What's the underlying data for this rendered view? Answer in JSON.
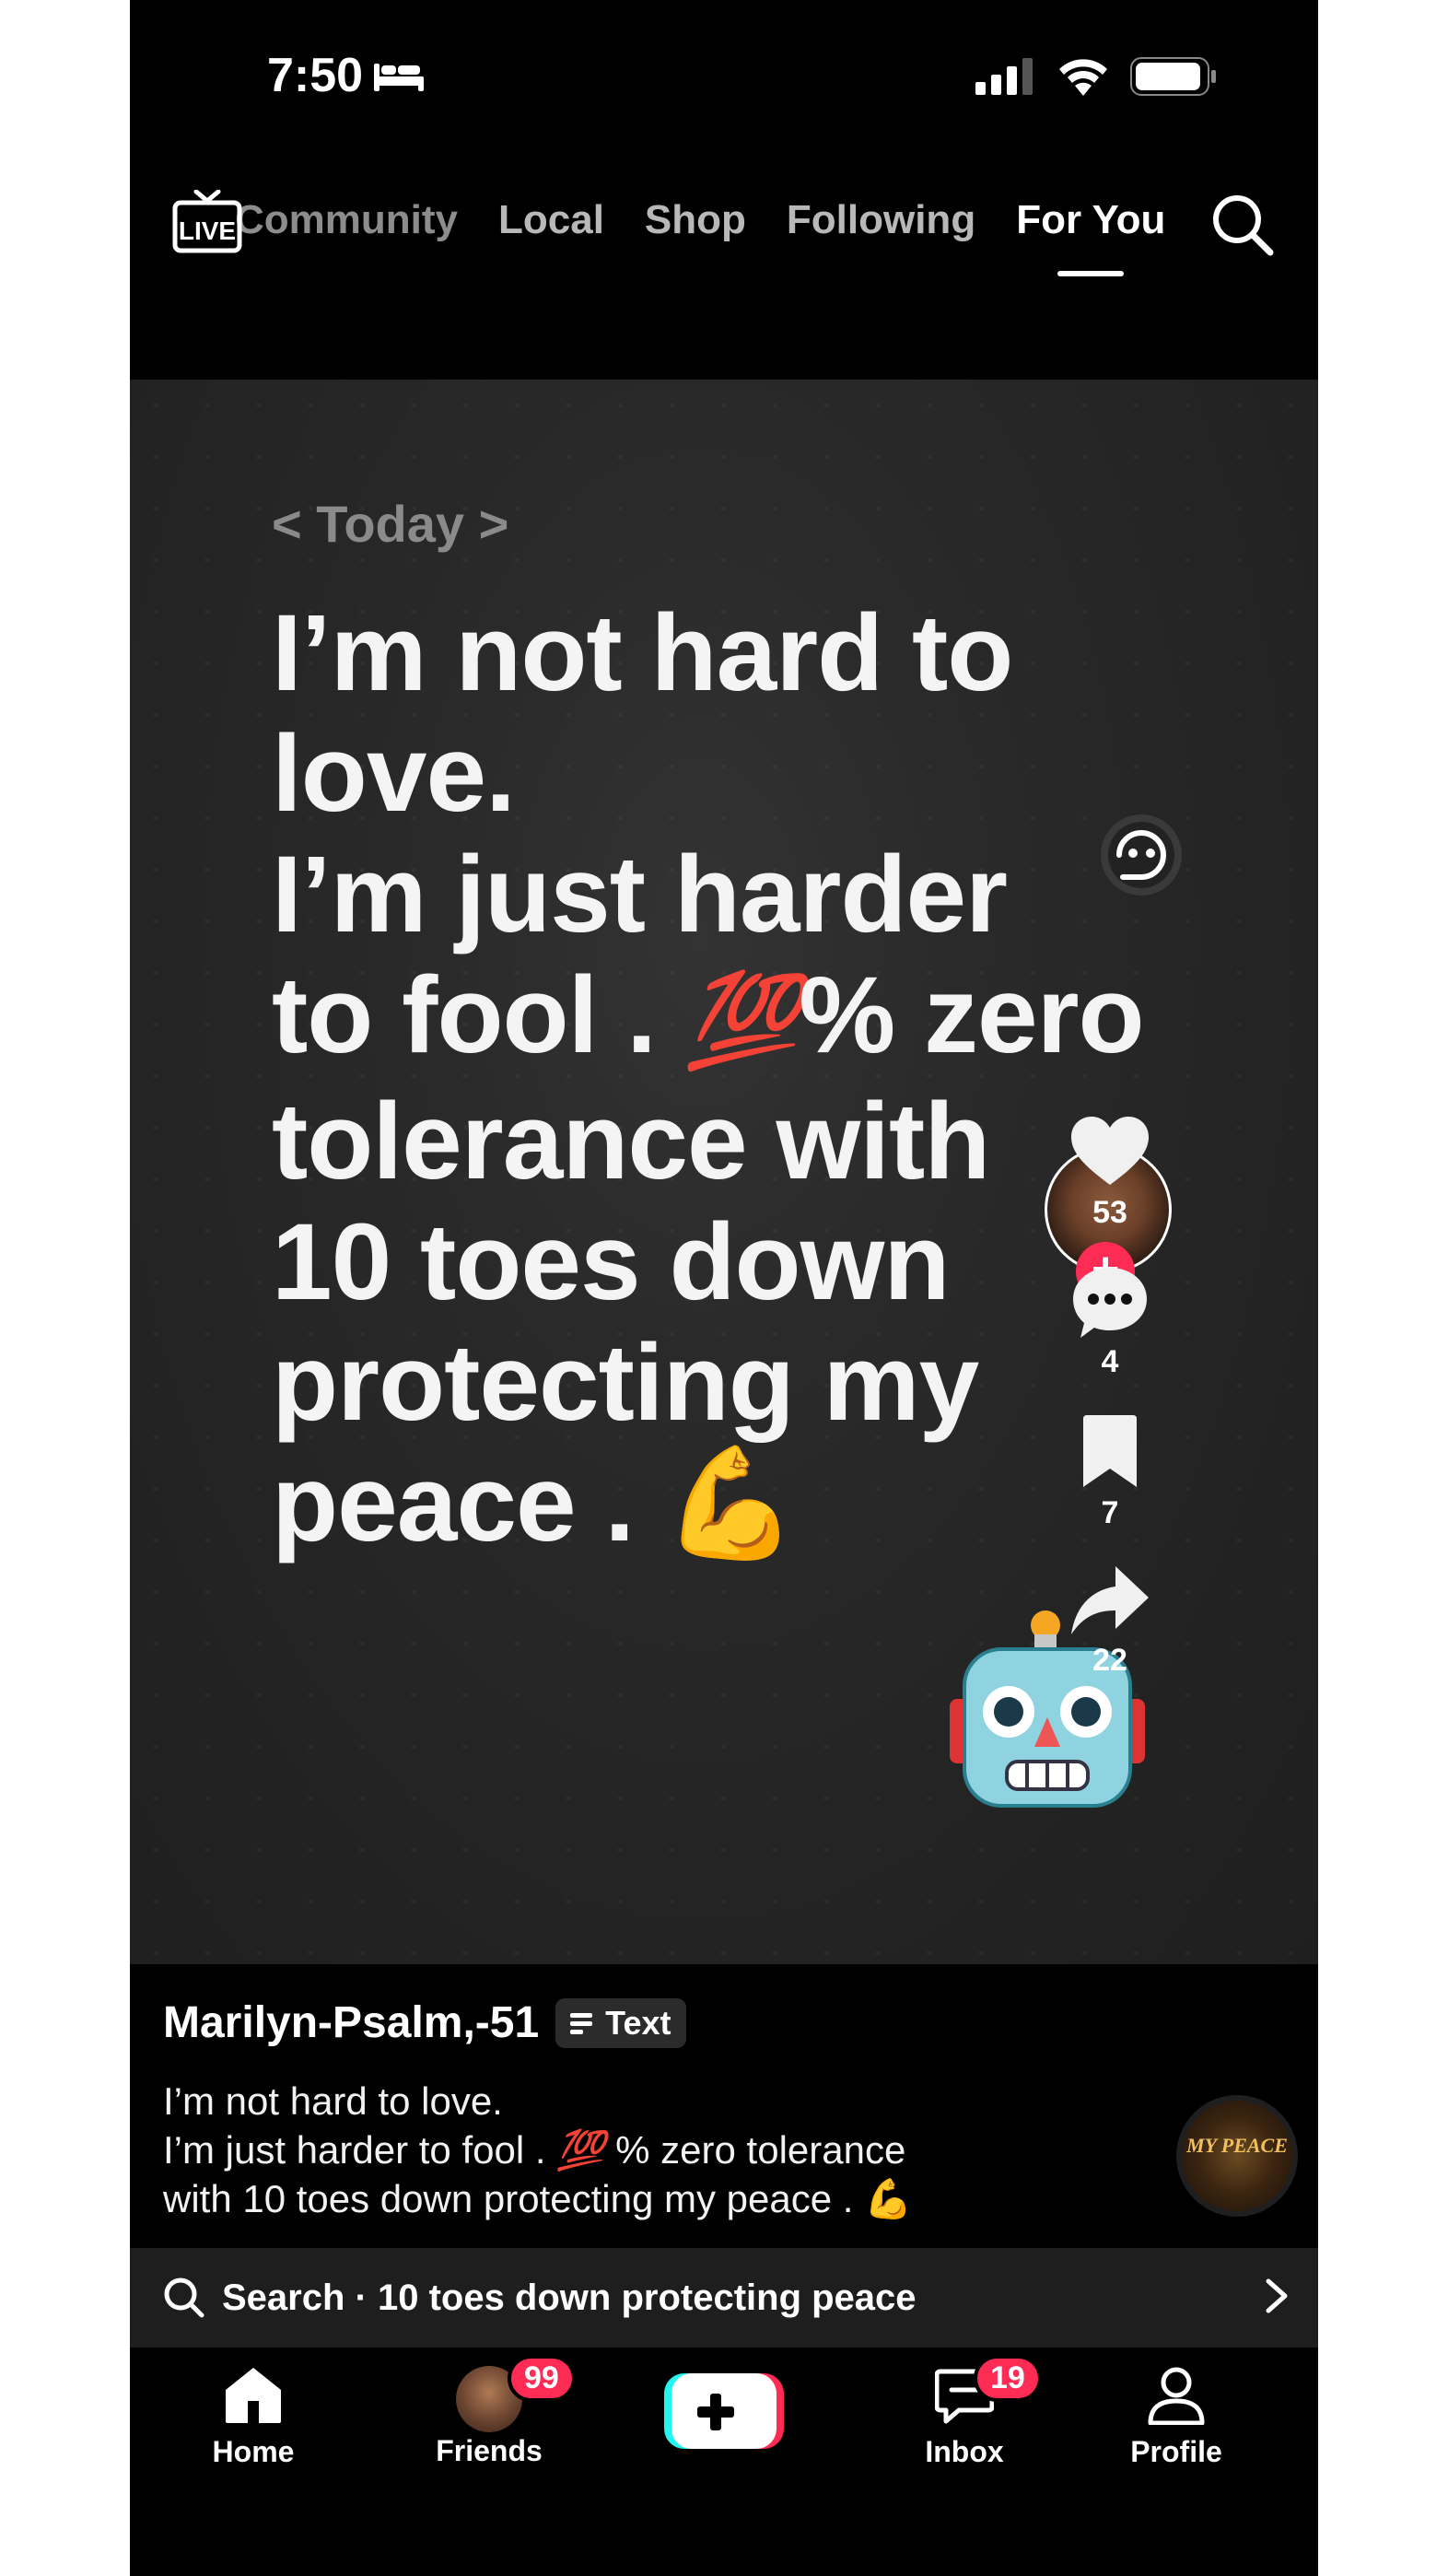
{
  "status_bar": {
    "time": "7:50"
  },
  "top_nav": {
    "tabs": [
      "Community",
      "Local",
      "Shop",
      "Following",
      "For You"
    ],
    "active_tab": "For You"
  },
  "video": {
    "today_label": "< Today >",
    "quote_lines": [
      "I’m not hard to",
      "love.",
      "I’m just harder",
      "to fool . ",
      "💯",
      "% zero",
      "tolerance with",
      "10 toes down",
      "protecting my",
      "peace . 💪"
    ]
  },
  "actions": {
    "likes": "53",
    "comments": "4",
    "bookmarks": "7",
    "shares": "22"
  },
  "caption": {
    "author": "Marilyn-Psalm,-51",
    "badge_label": "Text",
    "line1": "I’m not hard to love.",
    "line2_prefix": "I’m just harder to fool . ",
    "line2_emoji": "💯",
    "line2_suffix": " % zero tolerance",
    "line3": "with 10 toes down protecting my peace . 💪"
  },
  "music_disc_text": "MY PEACE",
  "search_bar": {
    "text": "Search · 10 toes down protecting peace"
  },
  "bottom_nav": {
    "home": "Home",
    "friends": "Friends",
    "friends_badge": "99",
    "inbox": "Inbox",
    "inbox_badge": "19",
    "profile": "Profile"
  },
  "colors": {
    "accent": "#fe2c55",
    "background": "#000000",
    "video_bg": "#2a2a2a"
  },
  "icons": [
    "live-icon",
    "search-icon",
    "ai-face-icon",
    "heart-icon",
    "comment-icon",
    "bookmark-icon",
    "share-icon",
    "home-icon",
    "inbox-icon",
    "profile-icon",
    "plus-icon"
  ]
}
